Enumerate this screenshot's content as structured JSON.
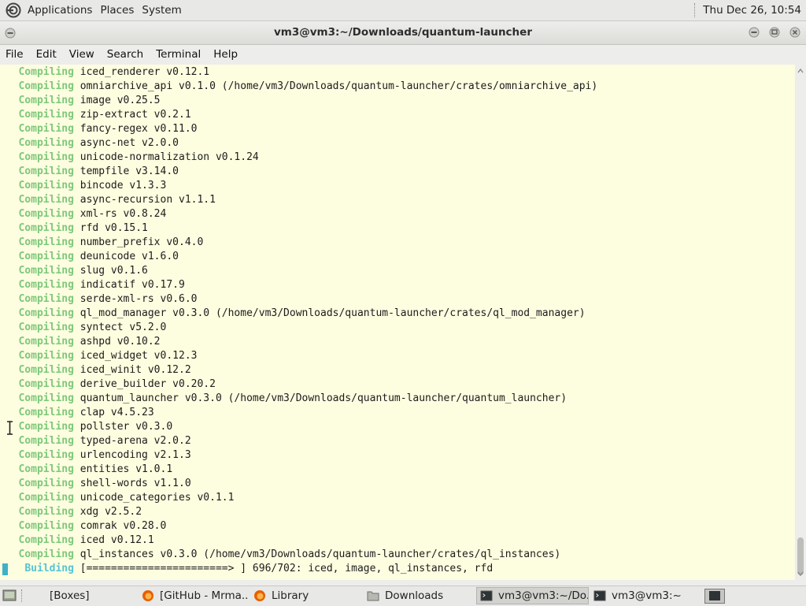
{
  "top_panel": {
    "menus": [
      "Applications",
      "Places",
      "System"
    ],
    "clock": "Thu Dec 26, 10:54"
  },
  "window": {
    "title": "vm3@vm3:~/Downloads/quantum-launcher"
  },
  "menubar": [
    "File",
    "Edit",
    "View",
    "Search",
    "Terminal",
    "Help"
  ],
  "terminal": {
    "lines": [
      {
        "kw": "Compiling",
        "text": " iced_renderer v0.12.1"
      },
      {
        "kw": "Compiling",
        "text": " omniarchive_api v0.1.0 (/home/vm3/Downloads/quantum-launcher/crates/omniarchive_api)"
      },
      {
        "kw": "Compiling",
        "text": " image v0.25.5"
      },
      {
        "kw": "Compiling",
        "text": " zip-extract v0.2.1"
      },
      {
        "kw": "Compiling",
        "text": " fancy-regex v0.11.0"
      },
      {
        "kw": "Compiling",
        "text": " async-net v2.0.0"
      },
      {
        "kw": "Compiling",
        "text": " unicode-normalization v0.1.24"
      },
      {
        "kw": "Compiling",
        "text": " tempfile v3.14.0"
      },
      {
        "kw": "Compiling",
        "text": " bincode v1.3.3"
      },
      {
        "kw": "Compiling",
        "text": " async-recursion v1.1.1"
      },
      {
        "kw": "Compiling",
        "text": " xml-rs v0.8.24"
      },
      {
        "kw": "Compiling",
        "text": " rfd v0.15.1"
      },
      {
        "kw": "Compiling",
        "text": " number_prefix v0.4.0"
      },
      {
        "kw": "Compiling",
        "text": " deunicode v1.6.0"
      },
      {
        "kw": "Compiling",
        "text": " slug v0.1.6"
      },
      {
        "kw": "Compiling",
        "text": " indicatif v0.17.9"
      },
      {
        "kw": "Compiling",
        "text": " serde-xml-rs v0.6.0"
      },
      {
        "kw": "Compiling",
        "text": " ql_mod_manager v0.3.0 (/home/vm3/Downloads/quantum-launcher/crates/ql_mod_manager)"
      },
      {
        "kw": "Compiling",
        "text": " syntect v5.2.0"
      },
      {
        "kw": "Compiling",
        "text": " ashpd v0.10.2"
      },
      {
        "kw": "Compiling",
        "text": " iced_widget v0.12.3"
      },
      {
        "kw": "Compiling",
        "text": " iced_winit v0.12.2"
      },
      {
        "kw": "Compiling",
        "text": " derive_builder v0.20.2"
      },
      {
        "kw": "Compiling",
        "text": " quantum_launcher v0.3.0 (/home/vm3/Downloads/quantum-launcher/quantum_launcher)"
      },
      {
        "kw": "Compiling",
        "text": " clap v4.5.23"
      },
      {
        "kw": "Compiling",
        "text": " pollster v0.3.0"
      },
      {
        "kw": "Compiling",
        "text": " typed-arena v2.0.2"
      },
      {
        "kw": "Compiling",
        "text": " urlencoding v2.1.3"
      },
      {
        "kw": "Compiling",
        "text": " entities v1.0.1"
      },
      {
        "kw": "Compiling",
        "text": " shell-words v1.1.0"
      },
      {
        "kw": "Compiling",
        "text": " unicode_categories v0.1.1"
      },
      {
        "kw": "Compiling",
        "text": " xdg v2.5.2"
      },
      {
        "kw": "Compiling",
        "text": " comrak v0.28.0"
      },
      {
        "kw": "Compiling",
        "text": " iced v0.12.1"
      },
      {
        "kw": "Compiling",
        "text": " ql_instances v0.3.0 (/home/vm3/Downloads/quantum-launcher/crates/ql_instances)"
      }
    ],
    "progress": {
      "kw": "Building",
      "text": " [=======================> ] 696/702: iced, image, ql_instances, rfd"
    }
  },
  "taskbar": {
    "items": [
      {
        "label": "[Boxes]",
        "icon": "boxes-icon"
      },
      {
        "label": "[GitHub - Mrma...",
        "icon": "firefox-icon"
      },
      {
        "label": "Library",
        "icon": "firefox-icon"
      },
      {
        "label": "Downloads",
        "icon": "folder-icon"
      },
      {
        "label": "vm3@vm3:~/Do...",
        "icon": "terminal-icon"
      },
      {
        "label": "vm3@vm3:~",
        "icon": "terminal-icon"
      }
    ]
  }
}
